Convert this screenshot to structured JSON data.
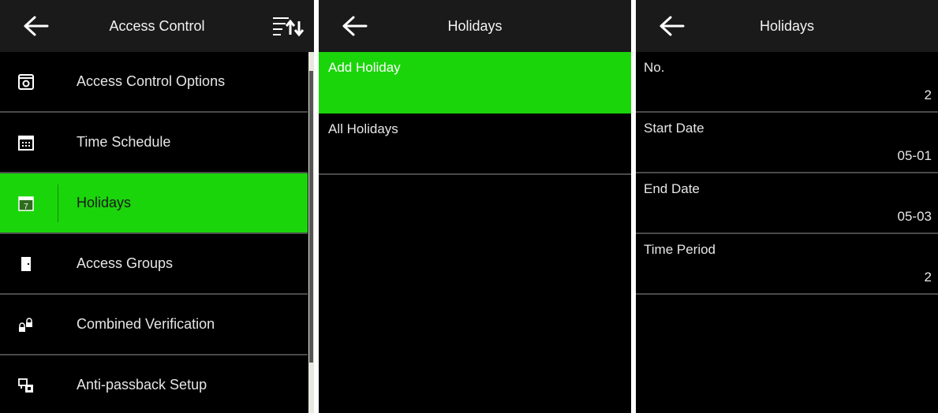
{
  "colors": {
    "accent_green": "#1bd50b",
    "background": "#000000",
    "header": "#1a1a1a"
  },
  "screen1": {
    "title": "Access Control",
    "back_icon": "arrow-left-icon",
    "sort_icon": "sort-list-icon",
    "items": [
      {
        "label": "Access Control Options",
        "icon": "door-lock-options-icon",
        "active": false
      },
      {
        "label": "Time Schedule",
        "icon": "calendar-icon",
        "active": false
      },
      {
        "label": "Holidays",
        "icon": "calendar-date-icon",
        "active": true
      },
      {
        "label": "Access Groups",
        "icon": "door-icon",
        "active": false
      },
      {
        "label": "Combined Verification",
        "icon": "double-lock-icon",
        "active": false
      },
      {
        "label": "Anti-passback Setup",
        "icon": "anti-passback-icon",
        "active": false
      }
    ]
  },
  "screen2": {
    "title": "Holidays",
    "back_icon": "arrow-left-icon",
    "items": [
      {
        "label": "Add Holiday",
        "active": true
      },
      {
        "label": "All Holidays",
        "active": false
      }
    ]
  },
  "screen3": {
    "title": "Holidays",
    "back_icon": "arrow-left-icon",
    "fields": [
      {
        "label": "No.",
        "value": "2"
      },
      {
        "label": "Start Date",
        "value": "05-01"
      },
      {
        "label": "End Date",
        "value": "05-03"
      },
      {
        "label": "Time Period",
        "value": "2"
      }
    ]
  }
}
